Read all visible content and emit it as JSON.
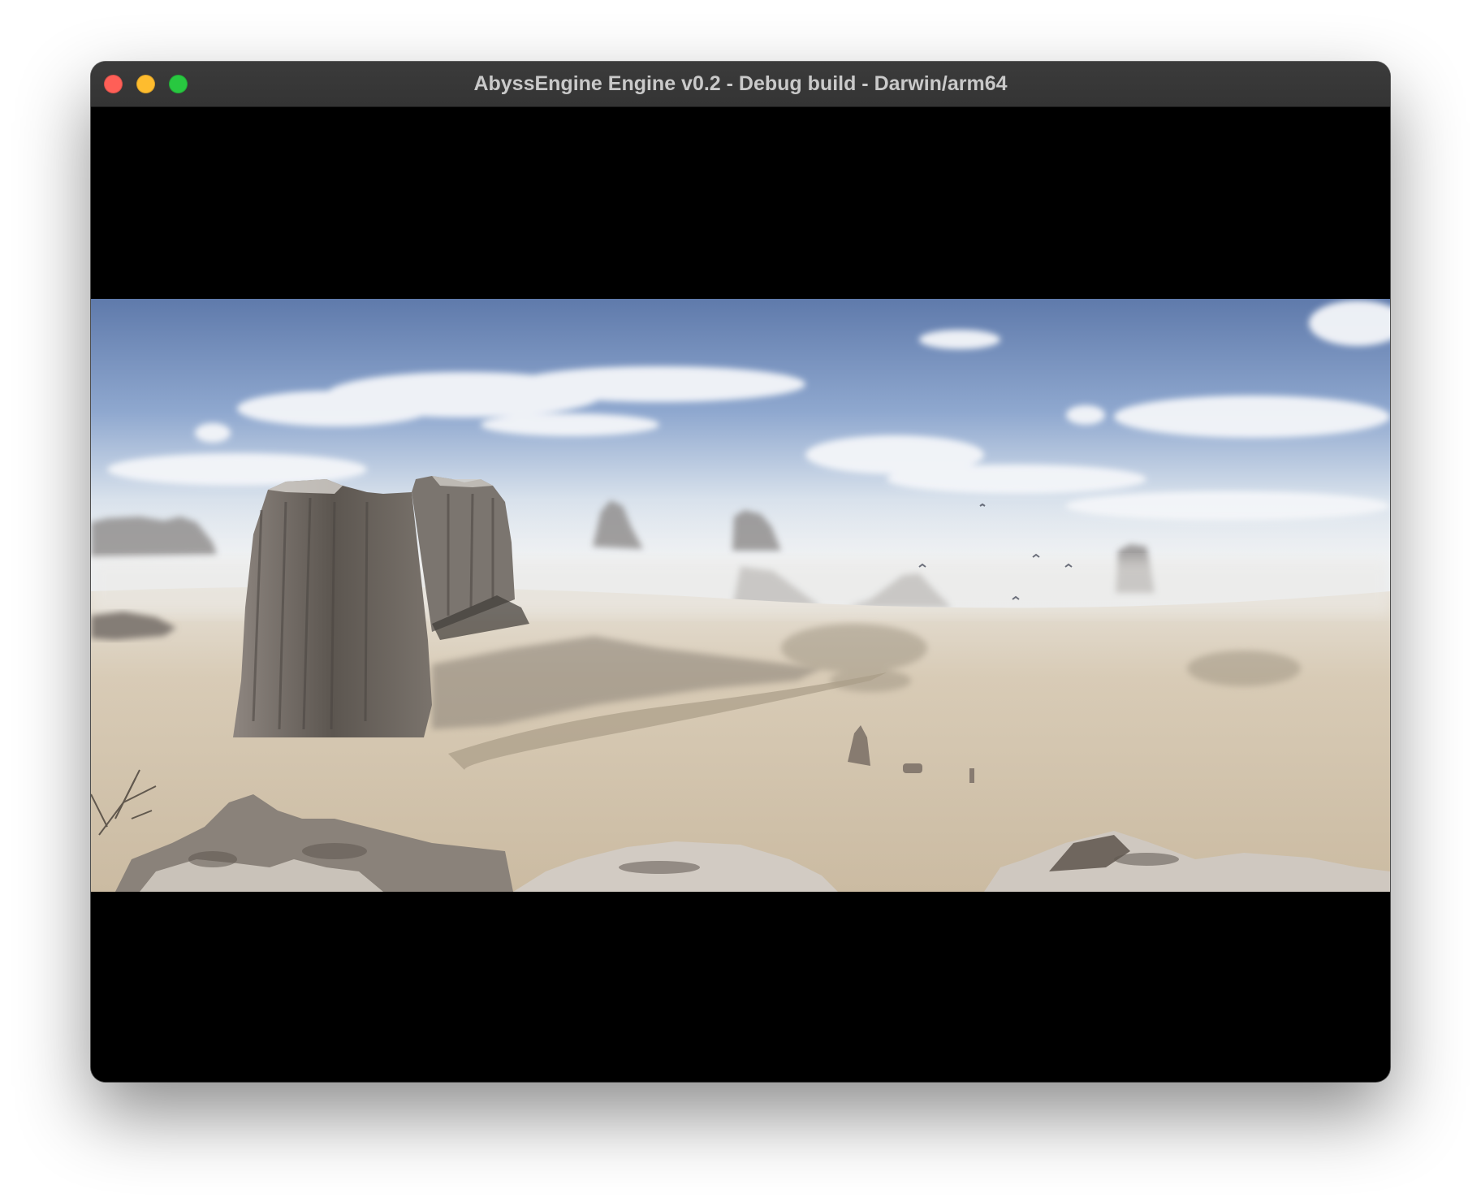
{
  "window": {
    "title": "AbyssEngine Engine v0.2 - Debug build - Darwin/arm64",
    "controls": [
      "close-button",
      "minimize-button",
      "zoom-button"
    ]
  },
  "viewport": {
    "content": "desert-landscape-cinematic-frame",
    "colors": {
      "sky_top": "#6a86b8",
      "sky_horizon": "#e8edf2",
      "ground": "#d8cbb6",
      "rock": "#6b6560",
      "letterbox": "#000000"
    }
  }
}
